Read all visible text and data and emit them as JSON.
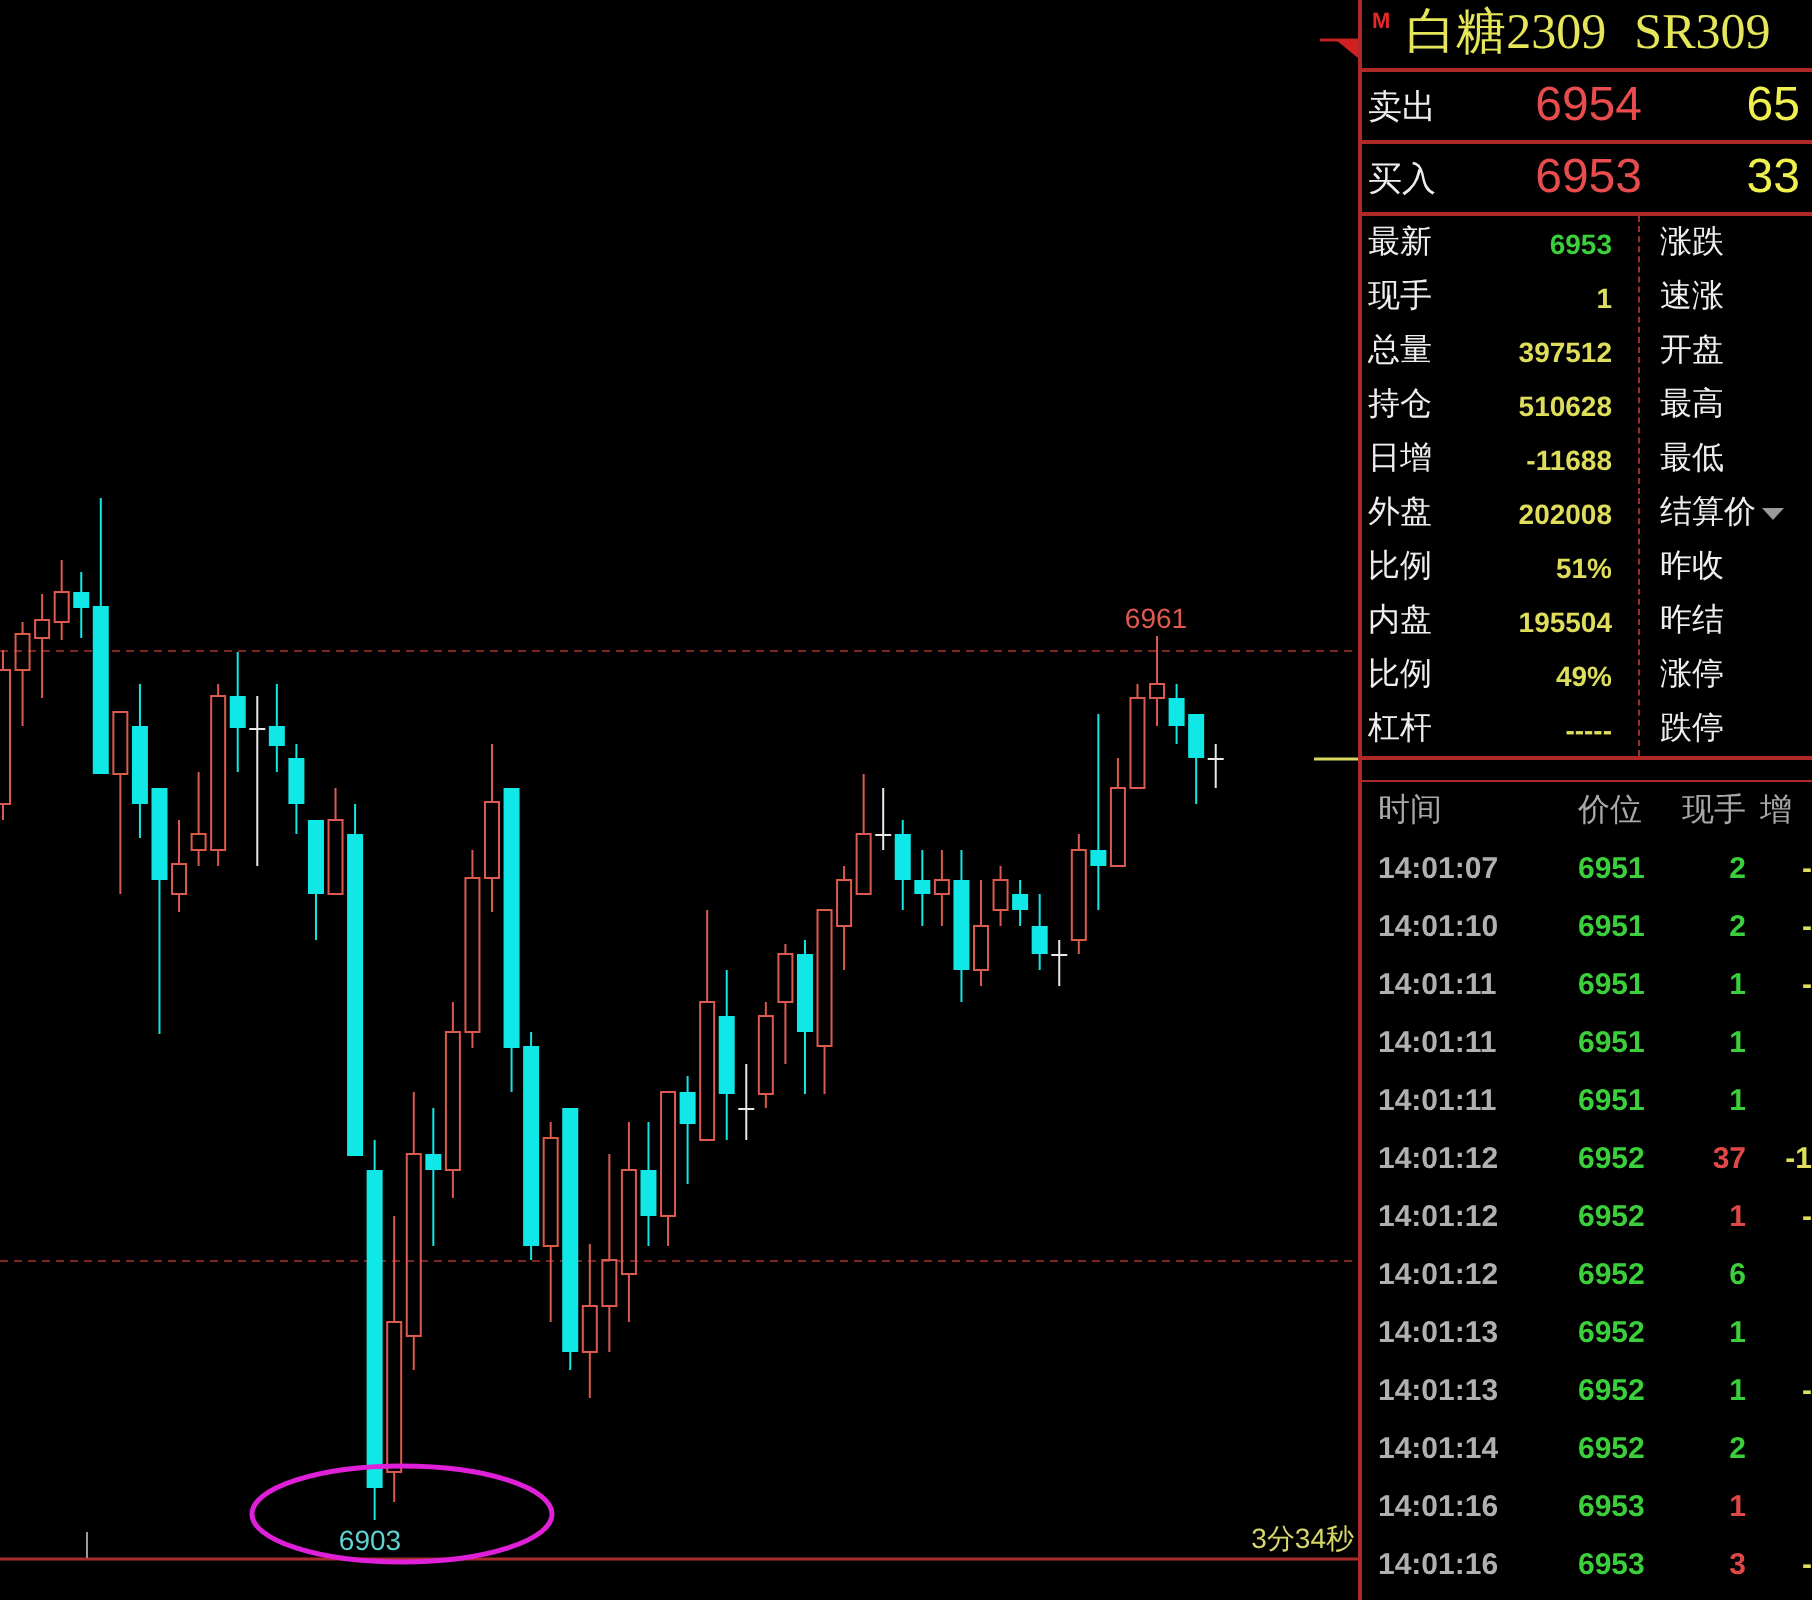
{
  "chart": {
    "high_label": "6961",
    "low_label": "6903",
    "timer": "3分34秒"
  },
  "quote_panel": {
    "header": {
      "badge": "M",
      "name": "白糖2309",
      "code": "SR309"
    },
    "order_book": [
      {
        "label": "卖出",
        "price": "6954",
        "volume": "65"
      },
      {
        "label": "买入",
        "price": "6953",
        "volume": "33"
      }
    ],
    "stats": [
      {
        "label": "最新",
        "value": {
          "text": "6953",
          "color": "#3ccf3c"
        },
        "right_label": "涨跌",
        "kind": "plain"
      },
      {
        "label": "现手",
        "value": {
          "text": "1",
          "color": "#dede5c"
        },
        "right_label": "速涨",
        "kind": "plain"
      },
      {
        "label": "总量",
        "value": {
          "text": "397512",
          "color": "#dede5c"
        },
        "right_label": "开盘",
        "kind": "plain"
      },
      {
        "label": "持仓",
        "value": {
          "text": "510628",
          "color": "#dede5c"
        },
        "right_label": "最高",
        "kind": "plain"
      },
      {
        "label": "日增",
        "value": {
          "text": "-11688",
          "color": "#dede5c"
        },
        "right_label": "最低",
        "kind": "plain"
      },
      {
        "label": "外盘",
        "value": {
          "text": "202008",
          "color": "#dede5c"
        },
        "right_label": "结算价",
        "kind": "dropdown"
      },
      {
        "label": "比例",
        "value": {
          "text": "51%",
          "color": "#dede5c"
        },
        "right_label": "昨收",
        "kind": "plain"
      },
      {
        "label": "内盘",
        "value": {
          "text": "195504",
          "color": "#dede5c"
        },
        "right_label": "昨结",
        "kind": "plain"
      },
      {
        "label": "比例",
        "value": {
          "text": "49%",
          "color": "#dede5c"
        },
        "right_label": "涨停",
        "kind": "plain"
      },
      {
        "label": "杠杆",
        "value": {
          "text": "-----",
          "color": "#dede5c"
        },
        "right_label": "跌停",
        "kind": "plain"
      }
    ]
  },
  "ticks": {
    "columns": [
      "时间",
      "价位",
      "现手",
      "增"
    ],
    "rows": [
      {
        "time": "14:01:07",
        "price": "6951",
        "volume": {
          "text": "2",
          "color": "#3ccf3c"
        },
        "change": "-"
      },
      {
        "time": "14:01:10",
        "price": "6951",
        "volume": {
          "text": "2",
          "color": "#3ccf3c"
        },
        "change": "-"
      },
      {
        "time": "14:01:11",
        "price": "6951",
        "volume": {
          "text": "1",
          "color": "#3ccf3c"
        },
        "change": "-"
      },
      {
        "time": "14:01:11",
        "price": "6951",
        "volume": {
          "text": "1",
          "color": "#3ccf3c"
        }
      },
      {
        "time": "14:01:11",
        "price": "6951",
        "volume": {
          "text": "1",
          "color": "#3ccf3c"
        }
      },
      {
        "time": "14:01:12",
        "price": "6952",
        "volume": {
          "text": "37",
          "color": "#e04848"
        },
        "change": "-1"
      },
      {
        "time": "14:01:12",
        "price": "6952",
        "volume": {
          "text": "1",
          "color": "#e04848"
        },
        "change": "-"
      },
      {
        "time": "14:01:12",
        "price": "6952",
        "volume": {
          "text": "6",
          "color": "#3ccf3c"
        }
      },
      {
        "time": "14:01:13",
        "price": "6952",
        "volume": {
          "text": "1",
          "color": "#3ccf3c"
        }
      },
      {
        "time": "14:01:13",
        "price": "6952",
        "volume": {
          "text": "1",
          "color": "#3ccf3c"
        },
        "change": "-"
      },
      {
        "time": "14:01:14",
        "price": "6952",
        "volume": {
          "text": "2",
          "color": "#3ccf3c"
        }
      },
      {
        "time": "14:01:16",
        "price": "6953",
        "volume": {
          "text": "1",
          "color": "#e04848"
        }
      },
      {
        "time": "14:01:16",
        "price": "6953",
        "volume": {
          "text": "3",
          "color": "#e04848"
        },
        "change": "-"
      }
    ]
  }
}
